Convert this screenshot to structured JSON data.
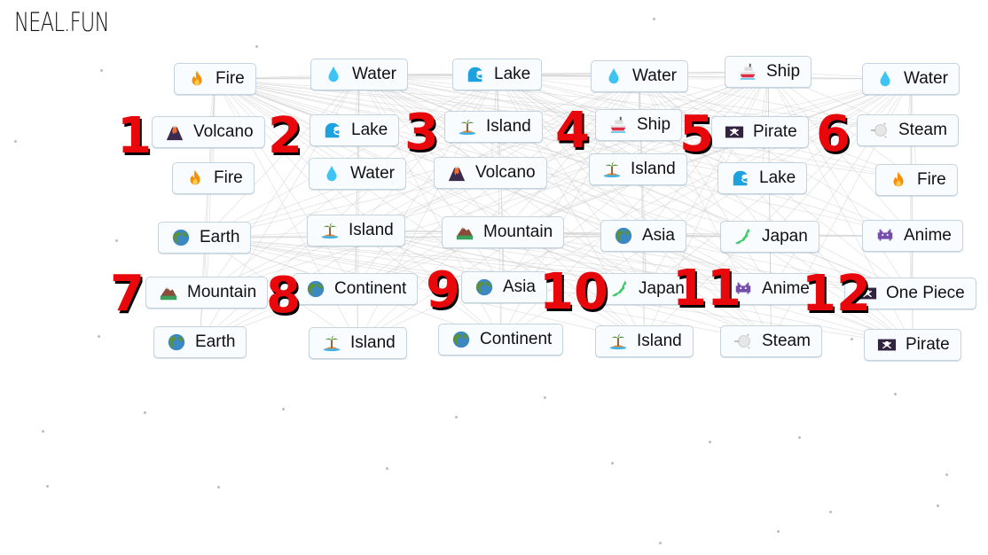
{
  "logo": "NEAL.FUN",
  "groups": [
    {
      "number": "1",
      "items": [
        {
          "label": "Fire",
          "icon": "fire"
        },
        {
          "label": "Volcano",
          "icon": "volcano"
        },
        {
          "label": "Fire",
          "icon": "fire"
        }
      ]
    },
    {
      "number": "2",
      "items": [
        {
          "label": "Water",
          "icon": "water"
        },
        {
          "label": "Lake",
          "icon": "wave"
        },
        {
          "label": "Water",
          "icon": "water"
        }
      ]
    },
    {
      "number": "3",
      "items": [
        {
          "label": "Lake",
          "icon": "wave"
        },
        {
          "label": "Island",
          "icon": "island"
        },
        {
          "label": "Volcano",
          "icon": "volcano"
        }
      ]
    },
    {
      "number": "4",
      "items": [
        {
          "label": "Water",
          "icon": "water"
        },
        {
          "label": "Ship",
          "icon": "ship"
        },
        {
          "label": "Island",
          "icon": "island"
        }
      ]
    },
    {
      "number": "5",
      "items": [
        {
          "label": "Ship",
          "icon": "ship"
        },
        {
          "label": "Pirate",
          "icon": "pirate-flag"
        },
        {
          "label": "Lake",
          "icon": "wave"
        }
      ]
    },
    {
      "number": "6",
      "items": [
        {
          "label": "Water",
          "icon": "water"
        },
        {
          "label": "Steam",
          "icon": "steam"
        },
        {
          "label": "Fire",
          "icon": "fire"
        }
      ]
    },
    {
      "number": "7",
      "items": [
        {
          "label": "Earth",
          "icon": "globe"
        },
        {
          "label": "Mountain",
          "icon": "mountain"
        },
        {
          "label": "Earth",
          "icon": "globe"
        }
      ]
    },
    {
      "number": "8",
      "items": [
        {
          "label": "Island",
          "icon": "island"
        },
        {
          "label": "Continent",
          "icon": "globe"
        },
        {
          "label": "Island",
          "icon": "island"
        }
      ]
    },
    {
      "number": "9",
      "items": [
        {
          "label": "Mountain",
          "icon": "mountain"
        },
        {
          "label": "Asia",
          "icon": "globe"
        },
        {
          "label": "Continent",
          "icon": "globe"
        }
      ]
    },
    {
      "number": "10",
      "items": [
        {
          "label": "Asia",
          "icon": "globe"
        },
        {
          "label": "Japan",
          "icon": "japan-map"
        },
        {
          "label": "Island",
          "icon": "island"
        }
      ]
    },
    {
      "number": "11",
      "items": [
        {
          "label": "Japan",
          "icon": "japan-map"
        },
        {
          "label": "Anime",
          "icon": "space-invader"
        },
        {
          "label": "Steam",
          "icon": "steam"
        }
      ]
    },
    {
      "number": "12",
      "items": [
        {
          "label": "Anime",
          "icon": "space-invader"
        },
        {
          "label": "One Piece",
          "icon": "pirate-flag"
        },
        {
          "label": "Pirate",
          "icon": "pirate-flag"
        }
      ]
    }
  ]
}
